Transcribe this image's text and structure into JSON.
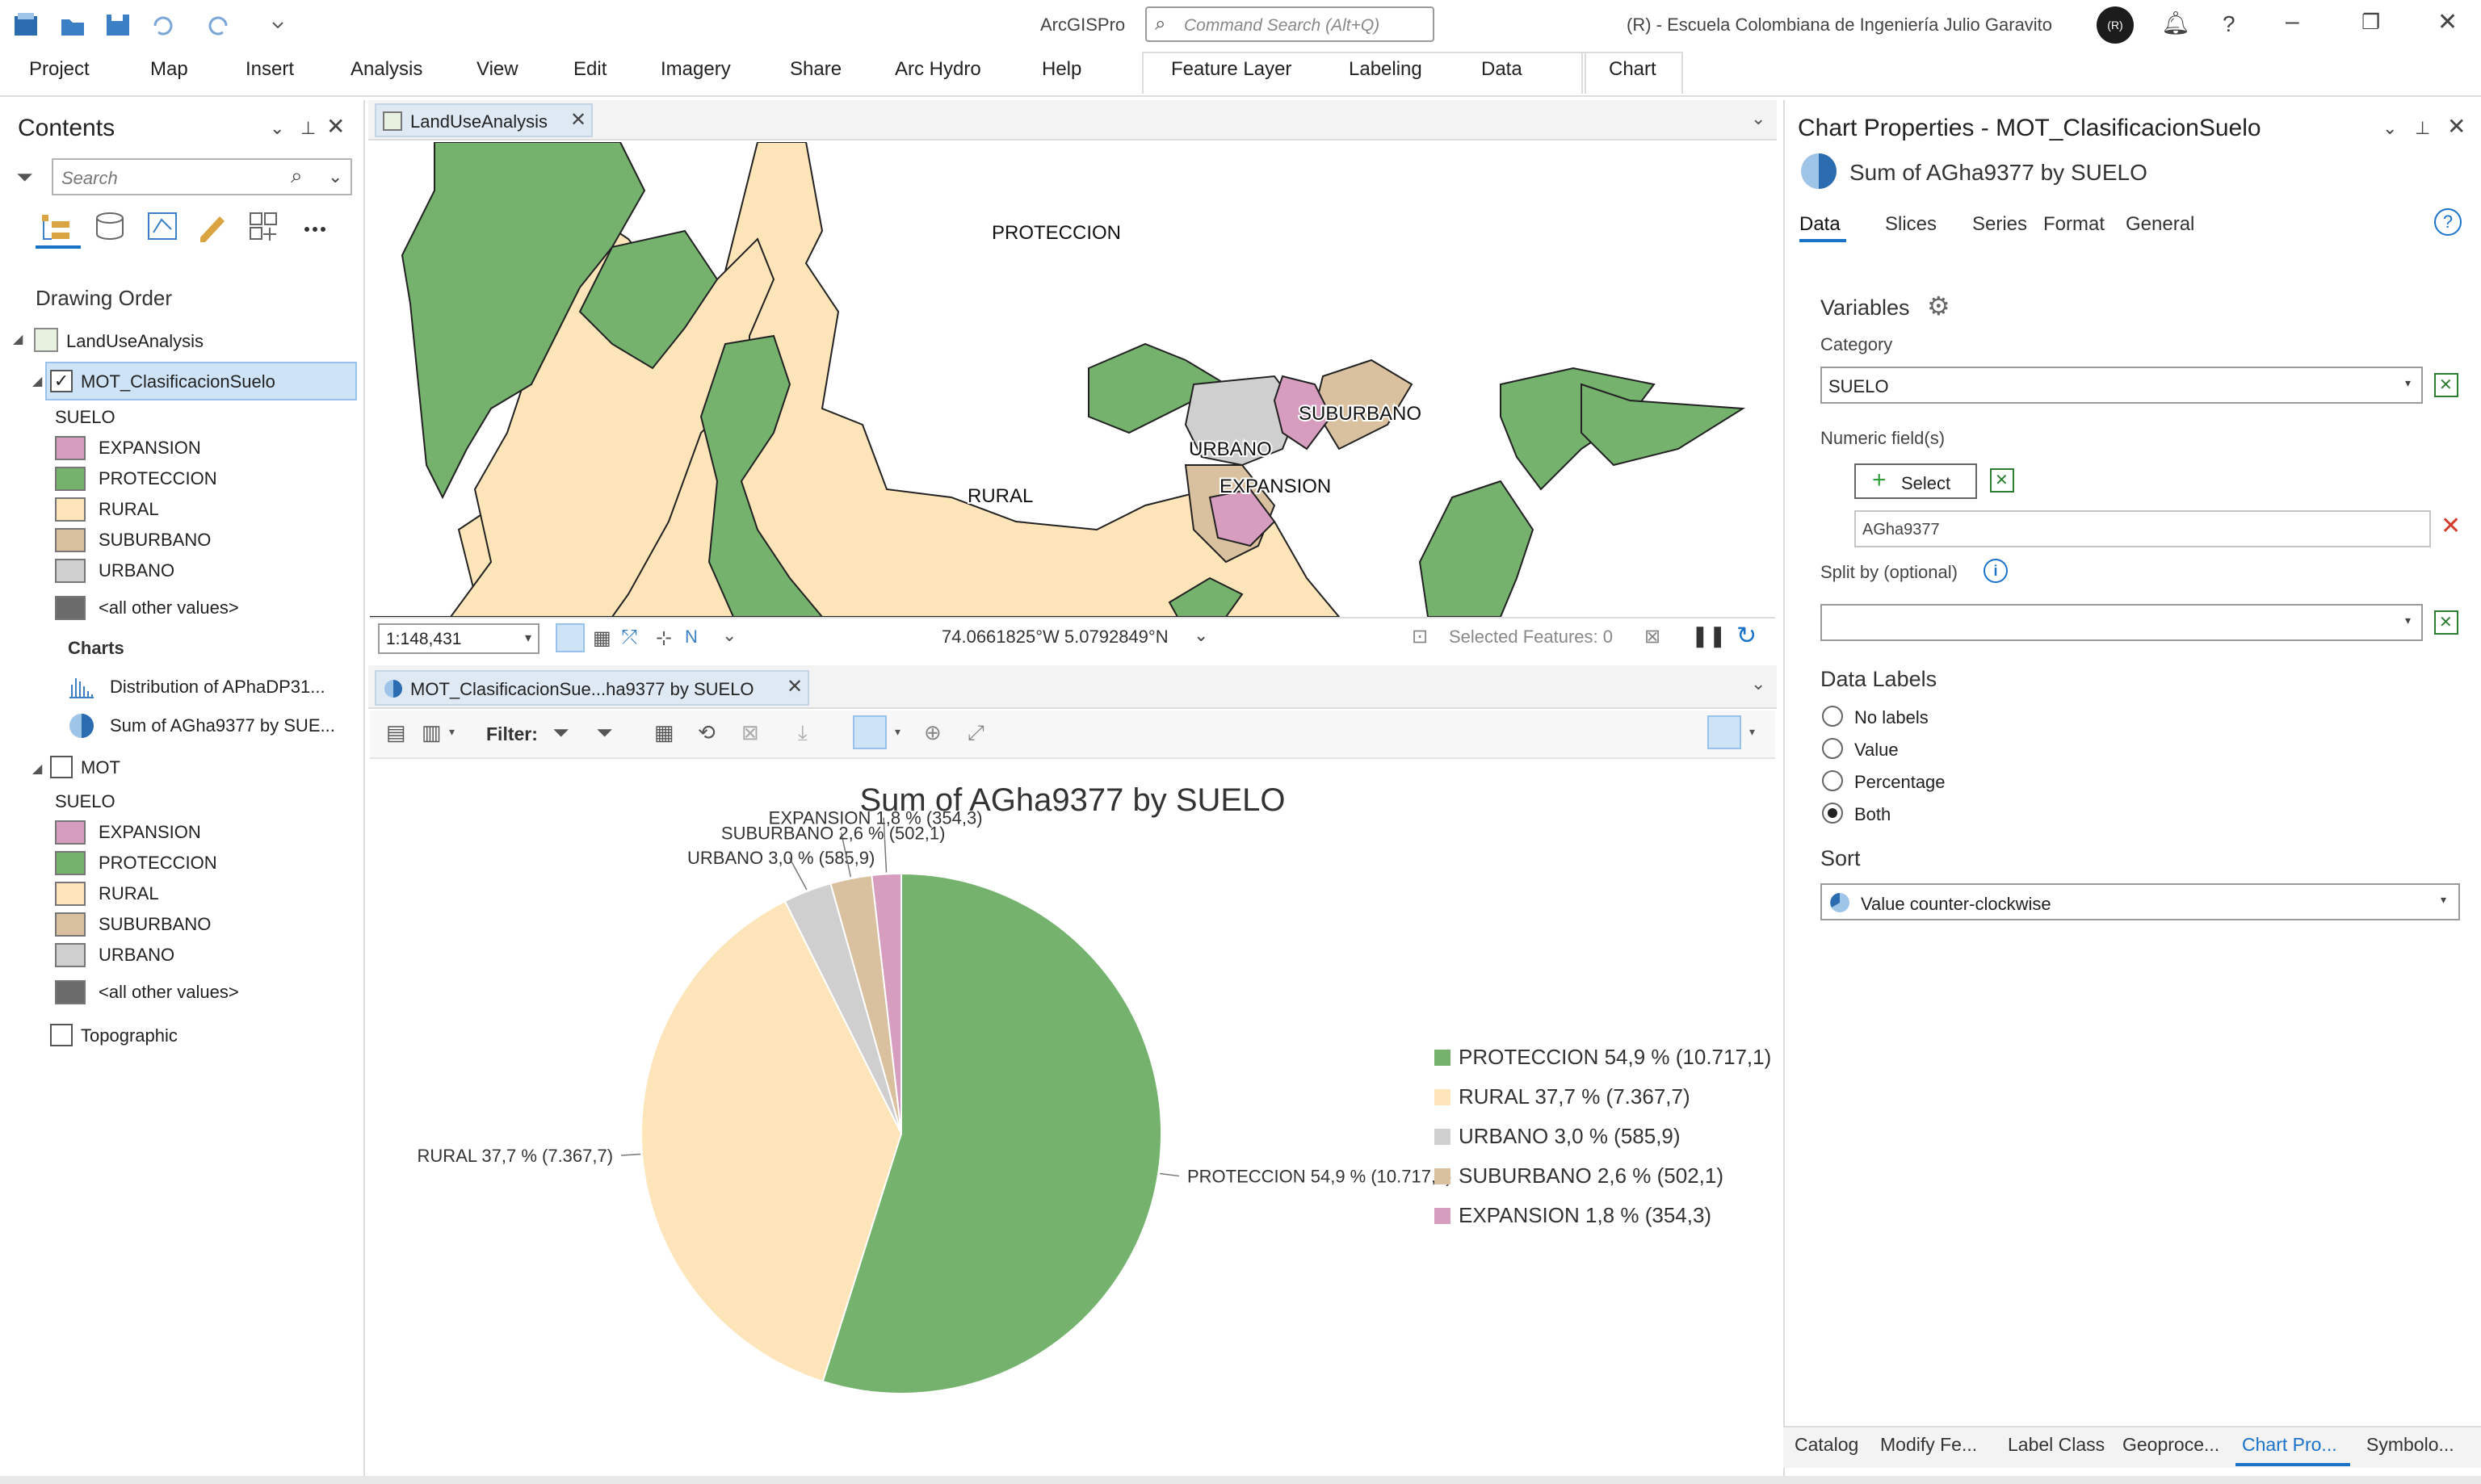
{
  "app": {
    "title": "ArcGISPro",
    "search_placeholder": "Command Search (Alt+Q)",
    "org": "(R)  -  Escuela Colombiana de Ingeniería Julio Garavito",
    "avatar": "(R)"
  },
  "ribbon": {
    "tabs": [
      "Project",
      "Map",
      "Insert",
      "Analysis",
      "View",
      "Edit",
      "Imagery",
      "Share",
      "Arc Hydro",
      "Help",
      "Feature Layer",
      "Labeling",
      "Data",
      "Chart"
    ]
  },
  "contents": {
    "title": "Contents",
    "search_placeholder": "Search",
    "drawing_order": "Drawing Order",
    "map_name": "LandUseAnalysis",
    "layer1": "MOT_ClasificacionSuelo",
    "field": "SUELO",
    "legend": [
      "EXPANSION",
      "PROTECCION",
      "RURAL",
      "SUBURBANO",
      "URBANO",
      "<all other values>"
    ],
    "charts_hdr": "Charts",
    "chart1": "Distribution of APhaDP31...",
    "chart2": "Sum of AGha9377 by SUE...",
    "layer2": "MOT",
    "field2": "SUELO",
    "legend2": [
      "EXPANSION",
      "PROTECCION",
      "RURAL",
      "SUBURBANO",
      "URBANO",
      "<all other values>"
    ],
    "layer3": "Topographic"
  },
  "colors": {
    "expansion": "#d69dbf",
    "proteccion": "#74b26e",
    "rural": "#fde5b9",
    "suburbano": "#d9c09e",
    "urbano": "#cfcfcf",
    "other": "#6b6b6b",
    "accent": "#1a73c9"
  },
  "map": {
    "tab": "LandUseAnalysis",
    "labels": [
      "PROTECCION",
      "RURAL",
      "URBANO",
      "SUBURBANO",
      "EXPANSION"
    ],
    "scale": "1:148,431",
    "coords": "74.0661825°W 5.0792849°N",
    "selected": "Selected Features: 0"
  },
  "chart_view": {
    "tab": "MOT_ClasificacionSue...ha9377 by SUELO",
    "filter_label": "Filter:"
  },
  "chart_data": {
    "type": "pie",
    "title": "Sum of AGha9377 by SUELO",
    "slices": [
      {
        "name": "PROTECCION",
        "value": 10717.1,
        "pct": 54.9,
        "label": "PROTECCION 54,9 % (10.717,1)",
        "color": "#74b26e"
      },
      {
        "name": "RURAL",
        "value": 7367.7,
        "pct": 37.7,
        "label": "RURAL 37,7 % (7.367,7)",
        "color": "#fde5b9"
      },
      {
        "name": "URBANO",
        "value": 585.9,
        "pct": 3.0,
        "label": "URBANO 3,0 % (585,9)",
        "color": "#cfcfcf"
      },
      {
        "name": "SUBURBANO",
        "value": 502.1,
        "pct": 2.6,
        "label": "SUBURBANO 2,6 % (502,1)",
        "color": "#d9c09e"
      },
      {
        "name": "EXPANSION",
        "value": 354.3,
        "pct": 1.8,
        "label": "EXPANSION 1,8 % (354,3)",
        "color": "#d69dbf"
      }
    ],
    "legend_position": "right"
  },
  "props": {
    "title": "Chart Properties - MOT_ClasificacionSuelo",
    "subtitle": "Sum of AGha9377 by SUELO",
    "tabs": [
      "Data",
      "Slices",
      "Series",
      "Format",
      "General"
    ],
    "variables": "Variables",
    "category_label": "Category",
    "category_value": "SUELO",
    "numeric_label": "Numeric field(s)",
    "select_btn": "Select",
    "numeric_value": "AGha9377",
    "split_label": "Split by (optional)",
    "data_labels": "Data Labels",
    "radio": [
      "No labels",
      "Value",
      "Percentage",
      "Both"
    ],
    "sort": "Sort",
    "sort_value": "Value counter-clockwise"
  },
  "bottom_tabs": [
    "Catalog",
    "Modify Fe...",
    "Label Class",
    "Geoproce...",
    "Chart Pro...",
    "Symbolo..."
  ]
}
